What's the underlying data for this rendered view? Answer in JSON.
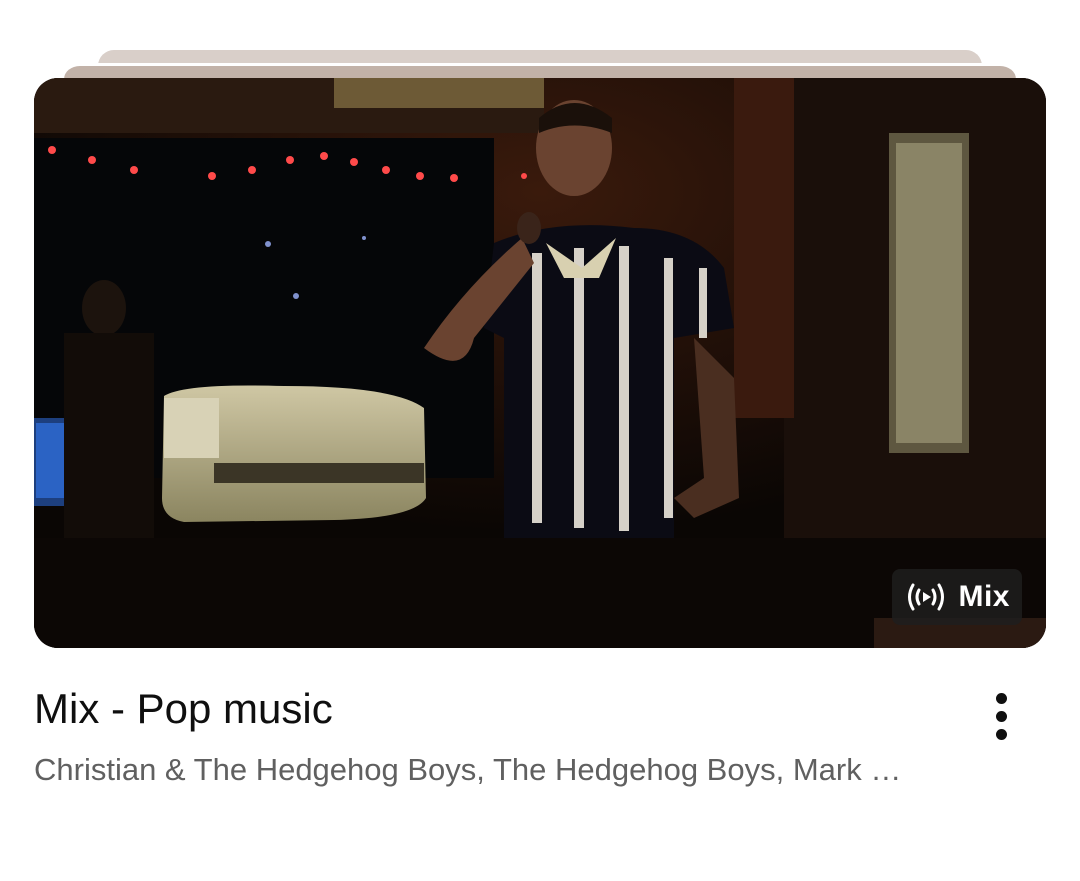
{
  "video": {
    "title": "Mix - Pop music",
    "channels": "Christian & The Hedgehog Boys, The Hedgehog Boys, Mark …",
    "badge": {
      "icon": "broadcast-icon",
      "label": "Mix"
    },
    "menu_icon": "more-vertical-icon"
  },
  "colors": {
    "title": "#0f0f0f",
    "subtitle": "#606060",
    "badge_bg": "#1e1e1e",
    "stack_back": "#d9cfc9",
    "stack_mid": "#c2b2a8"
  }
}
